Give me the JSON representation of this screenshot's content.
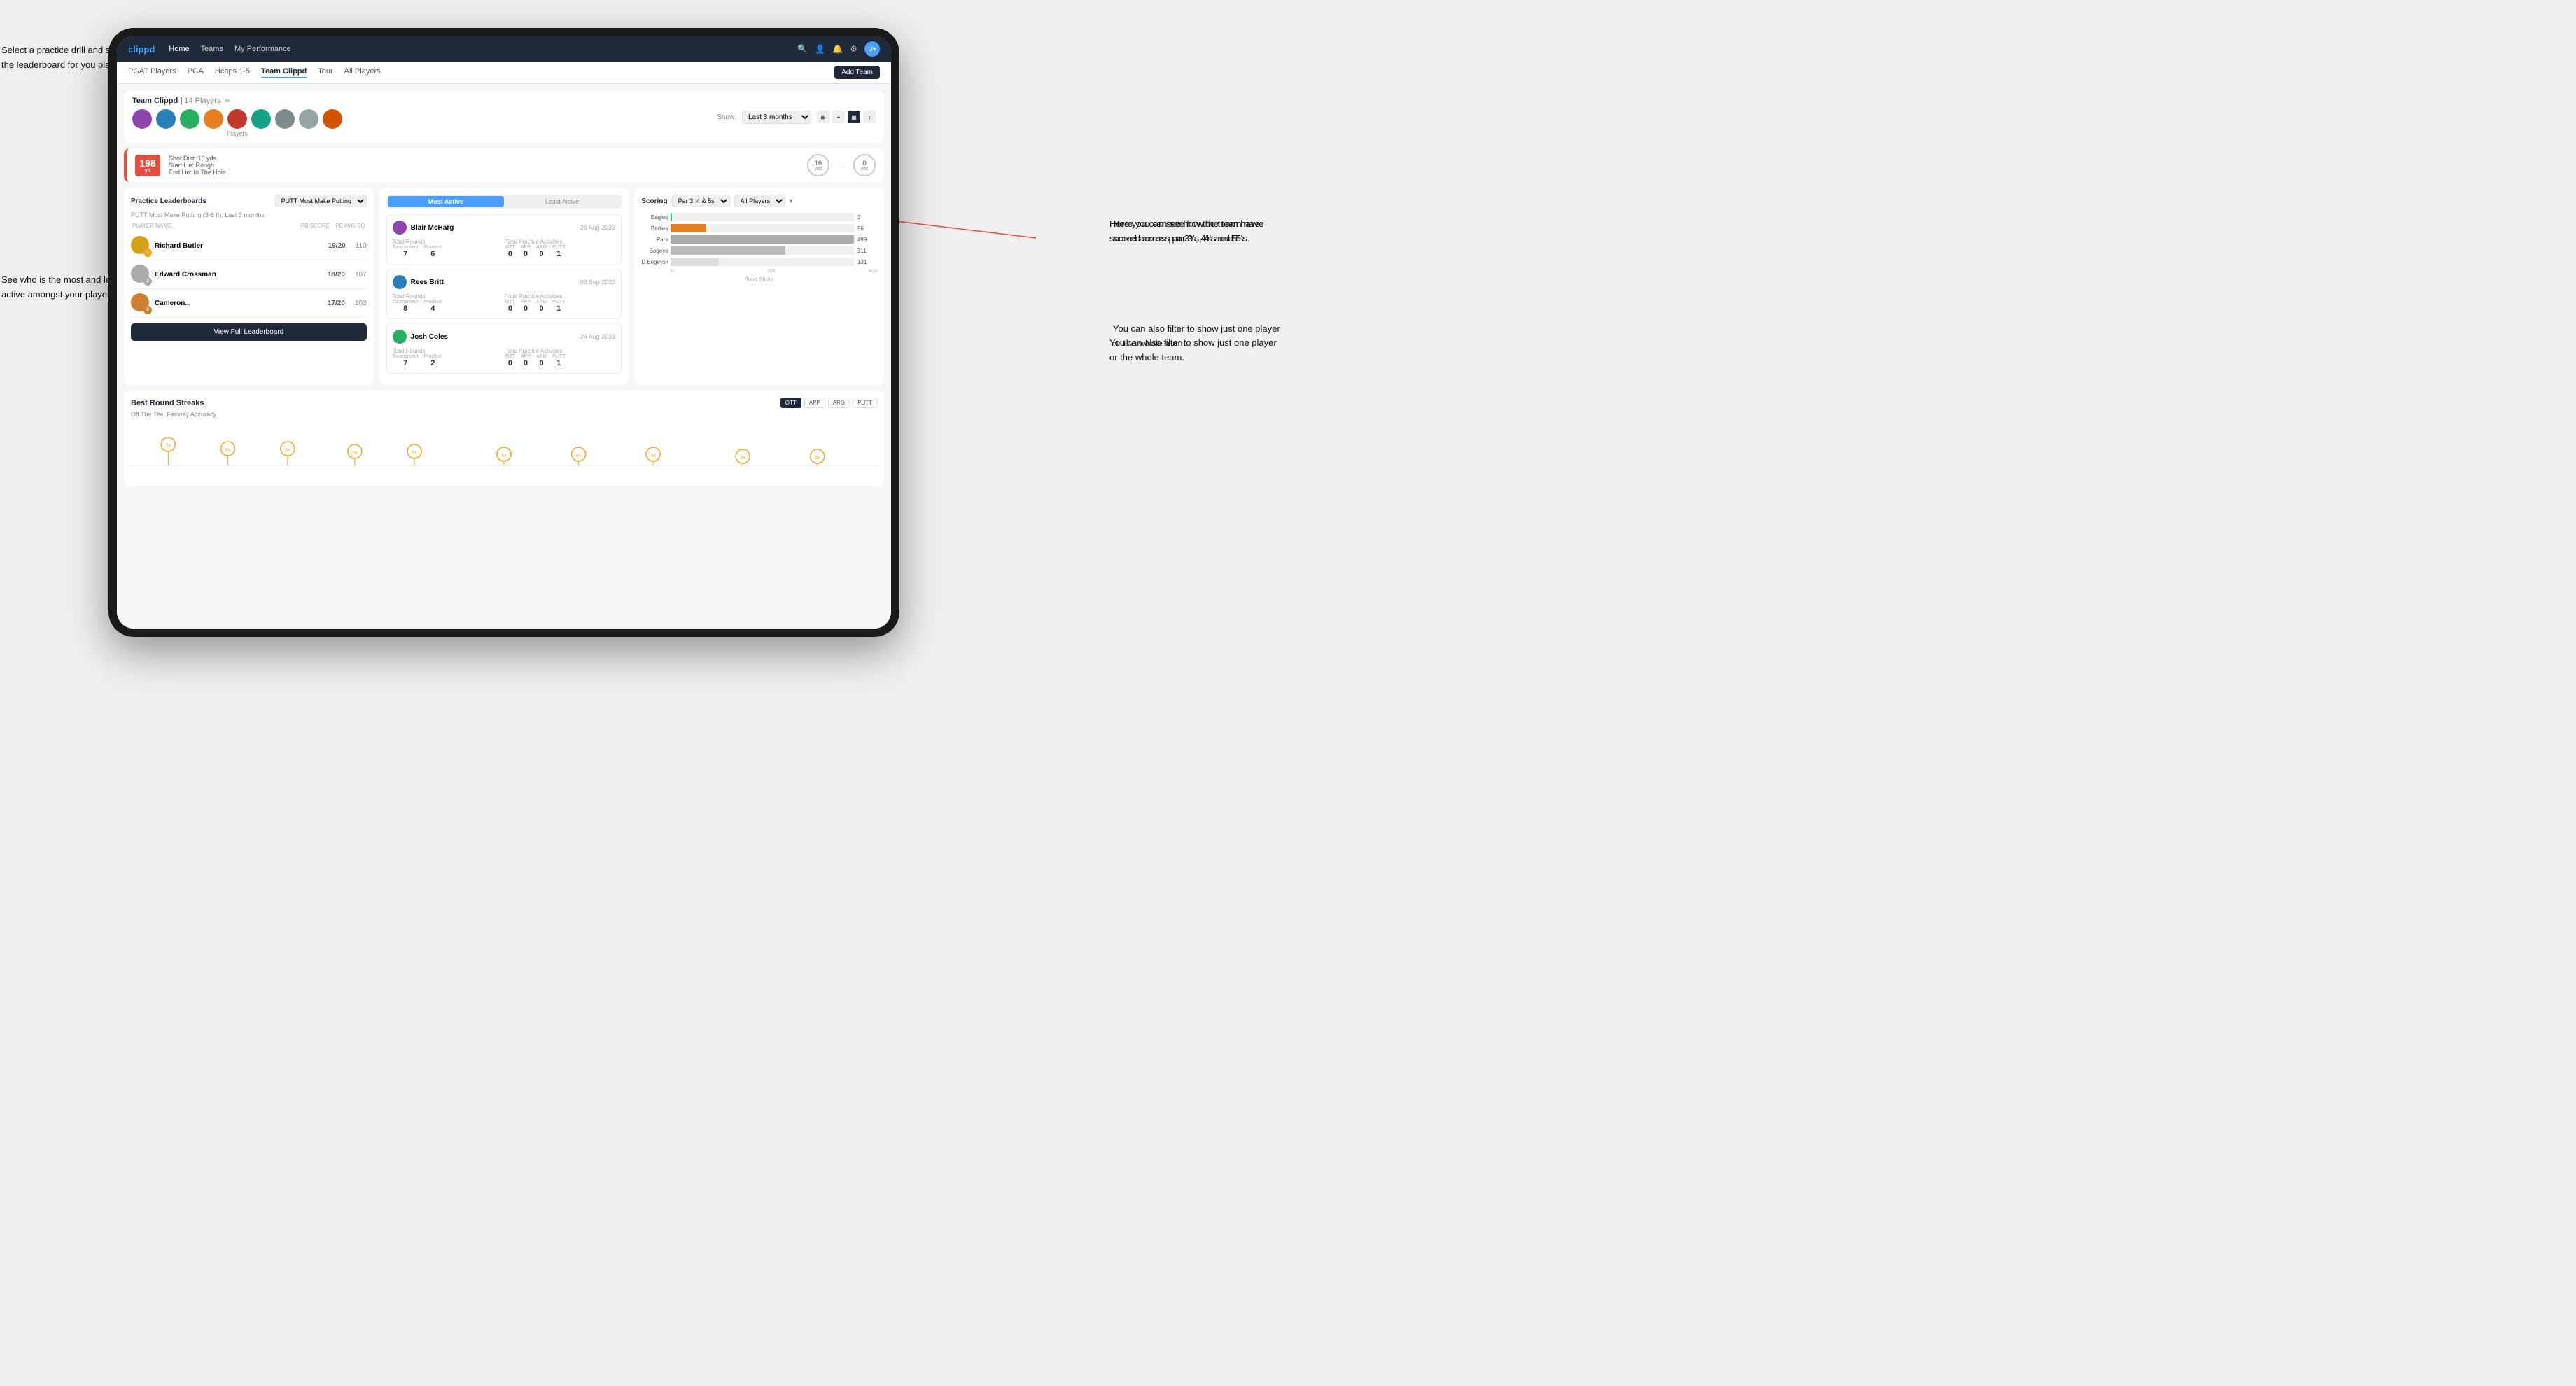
{
  "annotations": {
    "top_left_1": "Select a practice drill and see\nthe leaderboard for you players.",
    "bottom_left": "See who is the most and least\nactive amongst your players.",
    "right_1": "Here you can see how the\nteam have scored across\npar 3's, 4's and 5's.",
    "right_2": "You can also filter to show\njust one player or the whole\nteam."
  },
  "navbar": {
    "brand": "clippd",
    "links": [
      "Home",
      "Teams",
      "My Performance"
    ],
    "icons": [
      "search",
      "person",
      "bell",
      "settings",
      "avatar"
    ]
  },
  "subnav": {
    "tabs": [
      "PGAT Players",
      "PGA",
      "Hcaps 1-5",
      "Team Clippd",
      "Tour",
      "All Players"
    ],
    "active_tab": "Team Clippd",
    "add_team_label": "Add Team"
  },
  "team_header": {
    "title": "Team Clippd",
    "player_count": "14 Players",
    "show_label": "Show:",
    "show_period": "Last 3 months",
    "players_label": "Players"
  },
  "shot_info": {
    "dist": "198",
    "dist_unit": "yd",
    "dist_label": "Shot Dist: 16 yds",
    "start_lie": "Start Lie: Rough",
    "end_lie": "End Lie: In The Hole",
    "circle1_value": "16",
    "circle1_unit": "yds",
    "circle2_value": "0",
    "circle2_unit": "yds"
  },
  "practice_leaderboards": {
    "title": "Practice Leaderboards",
    "drill_name": "PUTT Must Make Putting",
    "drill_detail": "PUTT Must Make Putting (3-6 ft), Last 3 months",
    "cols": [
      "PLAYER NAME",
      "PB SCORE",
      "PB AVG SQ"
    ],
    "players": [
      {
        "rank": 1,
        "name": "Richard Butler",
        "score": "19/20",
        "avg": "110"
      },
      {
        "rank": 2,
        "name": "Edward Crossman",
        "score": "18/20",
        "avg": "107"
      },
      {
        "rank": 3,
        "name": "Cameron...",
        "score": "17/20",
        "avg": "103"
      }
    ],
    "view_full_label": "View Full Leaderboard"
  },
  "activity": {
    "tabs": [
      "Most Active",
      "Least Active"
    ],
    "active_tab": "Most Active",
    "players": [
      {
        "name": "Blair McHarg",
        "date": "26 Aug 2023",
        "total_rounds_label": "Total Rounds",
        "tournament_val": "7",
        "practice_val": "6",
        "total_practice_label": "Total Practice Activities",
        "ott": "0",
        "app": "0",
        "arg": "0",
        "putt": "1"
      },
      {
        "name": "Rees Britt",
        "date": "02 Sep 2023",
        "total_rounds_label": "Total Rounds",
        "tournament_val": "8",
        "practice_val": "4",
        "total_practice_label": "Total Practice Activities",
        "ott": "0",
        "app": "0",
        "arg": "0",
        "putt": "1"
      },
      {
        "name": "Josh Coles",
        "date": "26 Aug 2023",
        "total_rounds_label": "Total Rounds",
        "tournament_val": "7",
        "practice_val": "2",
        "total_practice_label": "Total Practice Activities",
        "ott": "0",
        "app": "0",
        "arg": "0",
        "putt": "1"
      }
    ]
  },
  "scoring": {
    "title": "Scoring",
    "filter1": "Par 3, 4 & 5s",
    "filter2": "All Players",
    "bars": [
      {
        "label": "Eagles",
        "value": 3,
        "max": 500,
        "class": "eagles"
      },
      {
        "label": "Birdies",
        "value": 96,
        "max": 500,
        "class": "birdies"
      },
      {
        "label": "Pars",
        "value": 499,
        "max": 500,
        "class": "pars"
      },
      {
        "label": "Bogeys",
        "value": 311,
        "max": 500,
        "class": "bogeys"
      },
      {
        "label": "D.Bogeys+",
        "value": 131,
        "max": 500,
        "class": "dbogeys"
      }
    ],
    "x_labels": [
      "0",
      "200",
      "400"
    ],
    "footer": "Total Shots"
  },
  "best_round_streaks": {
    "title": "Best Round Streaks",
    "buttons": [
      "OTT",
      "APP",
      "ARG",
      "PUTT"
    ],
    "active_btn": "OTT",
    "subtitle": "Off The Tee, Fairway Accuracy",
    "points": [
      {
        "x": 5,
        "label": "7x"
      },
      {
        "x": 12,
        "label": "6x"
      },
      {
        "x": 19,
        "label": "6x"
      },
      {
        "x": 27,
        "label": "5x"
      },
      {
        "x": 34,
        "label": "5x"
      },
      {
        "x": 42,
        "label": "4x"
      },
      {
        "x": 50,
        "label": "4x"
      },
      {
        "x": 57,
        "label": "4x"
      },
      {
        "x": 65,
        "label": "3x"
      },
      {
        "x": 73,
        "label": "3x"
      }
    ]
  }
}
